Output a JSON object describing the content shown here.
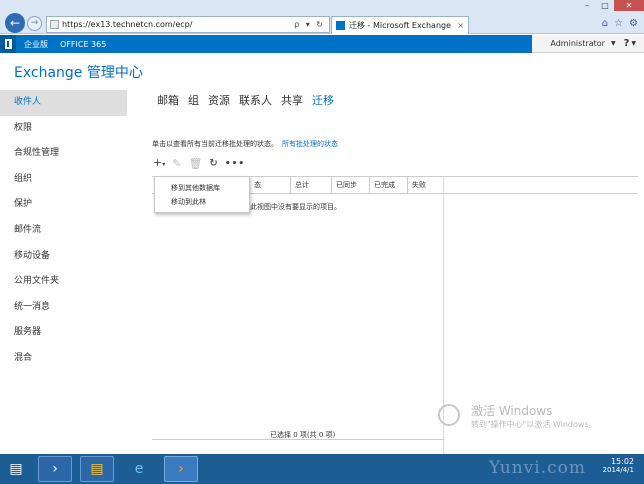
{
  "browser": {
    "url": "https://ex13.technetcn.com/ecp/",
    "address_tools": "ρ ▾ ↻",
    "tab_title": "迁移 - Microsoft Exchange",
    "tab_close": "×",
    "window_controls": [
      "–",
      "□",
      "✕"
    ],
    "toolbar_icons": [
      "home-icon",
      "star-icon",
      "gear-icon"
    ]
  },
  "o365_bar": {
    "edition": "企业版",
    "suite_link": "OFFICE 365",
    "user": "Administrator",
    "help": "?"
  },
  "page": {
    "title": "Exchange 管理中心"
  },
  "leftnav": {
    "items": [
      "收件人",
      "权限",
      "合规性管理",
      "组织",
      "保护",
      "邮件流",
      "移动设备",
      "公用文件夹",
      "统一消息",
      "服务器",
      "混合"
    ]
  },
  "tabs": {
    "items": [
      "邮箱",
      "组",
      "资源",
      "联系人",
      "共享",
      "迁移"
    ]
  },
  "info": {
    "text": "单击以查看所有当前迁移批处理的状态。",
    "link": "所有批处理的状态"
  },
  "toolbar": {
    "add": "+",
    "add_caret": "▾",
    "edit": "✎",
    "delete": "🗑",
    "refresh": "↻",
    "more": "•••"
  },
  "grid": {
    "columns": [
      "态",
      "总计",
      "已同步",
      "已完成",
      "失败"
    ],
    "empty_text": "此视图中没有要显示的项目。"
  },
  "menu": {
    "items": [
      "移到其他数据库",
      "移动到此林"
    ]
  },
  "status": {
    "selected": "已选择 0 项(共 0 项)"
  },
  "watermark": {
    "title": "激活 Windows",
    "subtitle": "转到\"操作中心\"以激活 Windows。"
  },
  "taskbar": {
    "time": "15:02",
    "date": "2014/4/1"
  },
  "brand_overlay": "Yunvi.com",
  "colors": {
    "accent": "#0072c6",
    "taskbar": "#1c5d96"
  }
}
